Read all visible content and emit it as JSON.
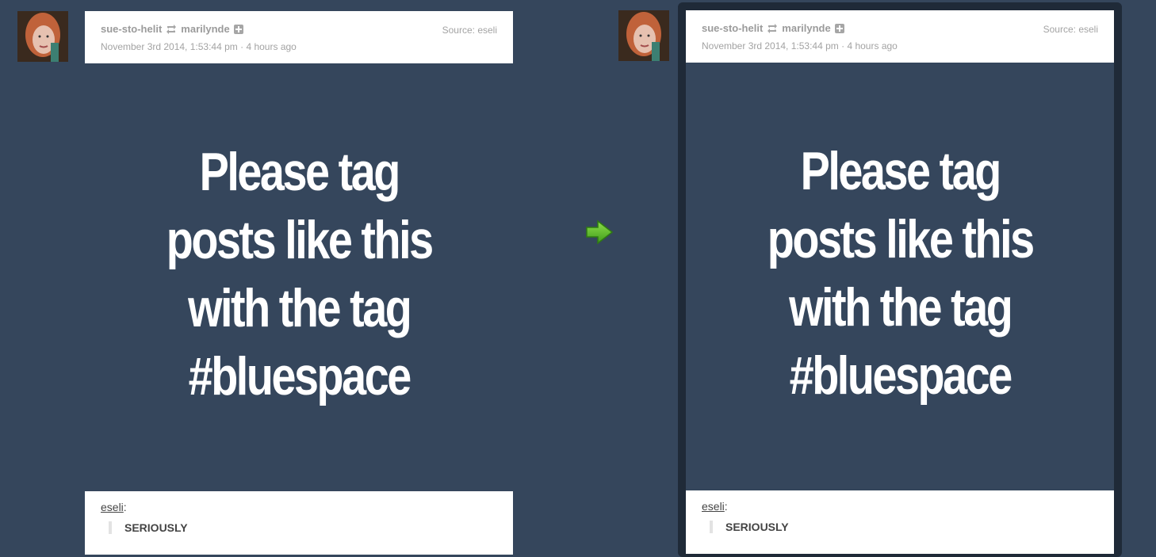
{
  "posts": [
    {
      "reblogger": "sue-sto-helit",
      "original_author": "marilynde",
      "date": "November 3rd 2014, 1:53:44 pm",
      "relative_time": "4 hours ago",
      "source_label": "Source: eseli",
      "image_lines": [
        "Please tag",
        "posts like this",
        "with the tag",
        "#bluespace"
      ],
      "quote_author": "eseli",
      "quote_suffix": ":",
      "quote_text": "SERIOUSLY"
    },
    {
      "reblogger": "sue-sto-helit",
      "original_author": "marilynde",
      "date": "November 3rd 2014, 1:53:44 pm",
      "relative_time": "4 hours ago",
      "source_label": "Source: eseli",
      "image_lines": [
        "Please tag",
        "posts like this",
        "with the tag",
        "#bluespace"
      ],
      "quote_author": "eseli",
      "quote_suffix": ":",
      "quote_text": "SERIOUSLY"
    }
  ],
  "meta_separator": " · ",
  "colors": {
    "background": "#35465c",
    "card": "#ffffff",
    "arrow": "#5cb82a"
  },
  "icons": {
    "reblog": "reblog-icon",
    "follow": "follow-plus-icon",
    "arrow": "arrow-right-icon"
  }
}
